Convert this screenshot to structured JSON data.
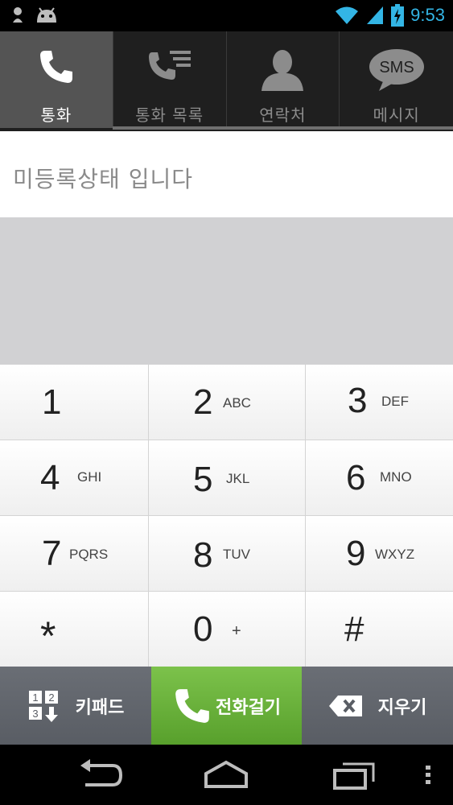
{
  "status_bar": {
    "time": "9:53",
    "icons": [
      "notification-dot-icon",
      "android-icon",
      "wifi-icon",
      "signal-icon",
      "battery-charging-icon"
    ],
    "accent": "#33b5e5"
  },
  "tabs": [
    {
      "label": "통화",
      "icon": "phone-icon",
      "active": true
    },
    {
      "label": "통화 목록",
      "icon": "call-log-icon",
      "active": false
    },
    {
      "label": "연락처",
      "icon": "contact-person-icon",
      "active": false
    },
    {
      "label": "메시지",
      "icon": "sms-bubble-icon",
      "active": false,
      "icon_text": "SMS"
    }
  ],
  "number_area": {
    "status_text": "미등록상태 입니다"
  },
  "keypad": {
    "keys": [
      {
        "digit": "1",
        "letters": ""
      },
      {
        "digit": "2",
        "letters": "ABC"
      },
      {
        "digit": "3",
        "letters": "DEF"
      },
      {
        "digit": "4",
        "letters": "GHI"
      },
      {
        "digit": "5",
        "letters": "JKL"
      },
      {
        "digit": "6",
        "letters": "MNO"
      },
      {
        "digit": "7",
        "letters": "PQRS"
      },
      {
        "digit": "8",
        "letters": "TUV"
      },
      {
        "digit": "9",
        "letters": "WXYZ"
      },
      {
        "digit": "*",
        "letters": ""
      },
      {
        "digit": "0",
        "letters": "+"
      },
      {
        "digit": "#",
        "letters": ""
      }
    ]
  },
  "actions": {
    "keypad_label": "키패드",
    "call_label": "전화걸기",
    "delete_label": "지우기",
    "call_color": "#6cb33f"
  },
  "nav": {
    "icons": [
      "back-icon",
      "home-icon",
      "recent-apps-icon",
      "menu-dots-icon"
    ]
  }
}
